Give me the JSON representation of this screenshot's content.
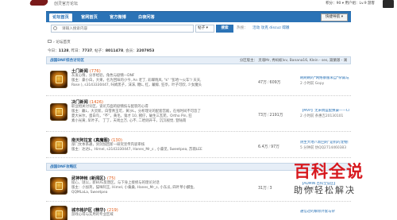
{
  "header": {
    "site_sub": "创灵官方论坛",
    "toplinks": "积分：90 ▾  用户组：Lv.9 游客"
  },
  "nav": {
    "tabs": [
      "论坛首页",
      "官网首页",
      "官方微博",
      "白夜问答"
    ],
    "quick_nav": "快捷导航 ▾"
  },
  "search": {
    "placeholder": "请输入搜索内容",
    "type": "帖子 ▾",
    "button": "搜索",
    "hot_label": "热搜：",
    "hot_words": "活动  攻克  discuz  嫦娥"
  },
  "breadcrumb": "› 论坛首页",
  "stats": {
    "today_label": "今日：",
    "today": "1128",
    "yesterday_label": "昨日：",
    "yesterday": "7737",
    "posts_label": "帖子：",
    "posts": "8011478",
    "members_label": "会员：",
    "members": "2207953"
  },
  "categories": [
    {
      "title": "战国DNF综合讨论区",
      "mods": "分区版主：  灵魂Mr,  秀蚂蚁lvv,  Banana16, Klein - ses, 諏蘭澈 - 澜"
    },
    {
      "title": "战国DNF攻略区",
      "mods": ""
    }
  ],
  "forums": [
    {
      "name": "土门新闻",
      "today": "(776)",
      "desc": [
        "灰发心情，分享经验，角色与剧情—DNF",
        "版主：豪小白，大果，名为回味的小今, An 老丁, 彩蝶晓风, \"k\"  \"彭哈～火车\"/ 天天, ",
        "Rose ), s3143330447,  咔姆黑子，沫沫, 糖L, 红，戴鲸, 狂亭，叶子可欣, 少女魔头"
      ],
      "threads": "47万",
      "posts": "609万",
      "last_title": "刷刷刷的*网络暴服来自*杂篇与旗",
      "last_meta": "2 小时前 Gopy"
    },
    {
      "name": "决门新闻",
      "today": "(1426)",
      "desc": [
        "职业相关讨论区，谈论方面的剧情技与配装的心得",
        "版主：戴L，大灵新，白雪青玉可，黄沙L，分析理论的配套宫殿，在线时间不可忽了",
        "夏大米尔，蛋白鸟，“不”，黄毛，鬼才 10, 猪仔，破生三瓦苑，Ortho Pin, 狂",
        "素小光黄, 早叶子，  丁丁，天戏立万, 心不, 二哈则开干，沉沉视觉, 登陆雨"
      ],
      "threads": "73万",
      "posts": "2191万",
      "last_title": "【MVP】无米绸蓝配换豪——Cloud...",
      "last_meta": "2 小时前 条惠吉20130101"
    },
    {
      "name": "南天阿拉宜 (真魔图)",
      "today": "(130)",
      "desc": [
        "部门文本系通，剑剑加回新—研究宣传内容审核",
        "版主：达达L，HimeI, s3143330447, Hanes_Mr_s , 小豪见, Sweetpea, 苏雨LEE"
      ],
      "threads": "6.4万",
      "posts": "97万",
      "last_title": "阴生大地八新回的“是机的宠物门”",
      "last_meta": "5 分钟前 仿QQ2714460383"
    },
    {
      "name": "武神神帐 (新闻区)",
      "today": "(75)",
      "desc": [
        "提心，谜以，新BUG反馈区，与下身上接修与的理论对话",
        "版主：小加英，猫咪阿王, HimeI, 小桑桑, Hanes_Mr_s, 小东瓜, 四叶草小麟鱼,",
        "QQMLaLa, Sweetpea"
      ],
      "threads": "31万",
      "posts": "3",
      "last_title": "【ADMIN 百科全说区】",
      "last_meta": "2 分钟前"
    },
    {
      "name": "城市格护区 (精华)",
      "today": "(219)",
      "desc": [
        "游戏心得与实用的专业区域"
      ],
      "threads": "",
      "posts": "",
      "last_title": "通信过的解除外套与杂",
      "last_meta": ""
    }
  ],
  "watermark": {
    "title": "百科全说",
    "sub": "助你轻松解决"
  }
}
